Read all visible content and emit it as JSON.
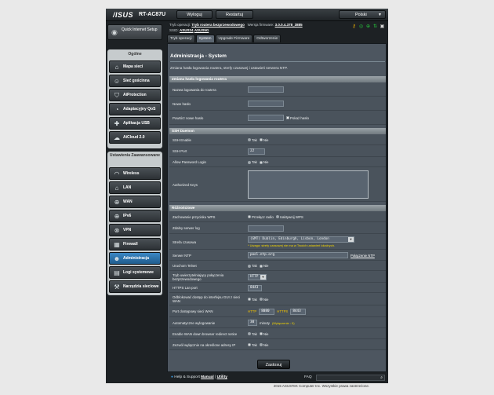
{
  "header": {
    "brand": "/ISUS",
    "model": "RT-AC87U",
    "logout_label": "Wyloguj",
    "restart_label": "Restartuj",
    "language_label": "Polski"
  },
  "info": {
    "mode_label": "Tryb operacji:",
    "mode_value": "Tryb routera bezprzewodowego",
    "fw_label": "Wersja firmware:",
    "fw_value": "3.0.0.4.378_3885",
    "ssid_label": "SSID:",
    "ssid_1": "ASUS24",
    "ssid_2": "ASUS5G"
  },
  "sidebar": {
    "qis_label": "Quick Internet Setup",
    "general_header": "Ogólne",
    "general_items": [
      {
        "label": "Mapa sieci"
      },
      {
        "label": "Sieć gościnna"
      },
      {
        "label": "AiProtection"
      },
      {
        "label": "Adaptacyjny QoS"
      },
      {
        "label": "Aplikacja USB"
      },
      {
        "label": "AiCloud 2.0"
      }
    ],
    "advanced_header": "Ustawienia Zaawansowane",
    "advanced_items": [
      {
        "label": "Wireless"
      },
      {
        "label": "LAN"
      },
      {
        "label": "WAN"
      },
      {
        "label": "IPv6"
      },
      {
        "label": "VPN"
      },
      {
        "label": "Firewall"
      },
      {
        "label": "Administracja"
      },
      {
        "label": "Logi systemowe"
      },
      {
        "label": "Narzędzia sieciowe"
      }
    ]
  },
  "tabs": [
    "Tryb operacji",
    "System",
    "Upgrade Firmware",
    "Odtworzenie"
  ],
  "page": {
    "title": "Administracja - System",
    "description": "Zmiana hasła logowania routera, strefy czasowej i ustawień serwera NTP.",
    "section_login": "Zmiana hasła logowania routera",
    "login_name_label": "Nazwa logowania do routera",
    "login_name_value": "",
    "new_pw_label": "Nowe hasło",
    "new_pw_value": "",
    "retype_pw_label": "Powtórz nowe hasło",
    "retype_pw_value": "",
    "show_pw_label": "Pokaż hasło",
    "section_ssh": "SSH Daemon",
    "ssh_enable_label": "SSH Enable",
    "ssh_port_label": "SSH Port",
    "ssh_port_value": "22",
    "allow_pw_label": "Allow Password Login",
    "auth_keys_label": "Authorized Keys",
    "section_misc": "Różnościowe",
    "wps_label": "Zachowanie przycisku WPS",
    "wps_opt1": "Przełącz radio",
    "wps_opt2": "Uaktywnij WPS",
    "remote_log_label": "Zdalny serwer log",
    "remote_log_value": "",
    "timezone_label": "Strefa czasowa",
    "timezone_value": "(GMT) Dublin, Edinburgh, Lisbon, London",
    "timezone_warning": "* Uwaga: strefy czasowej nie ma w Twoich ustawień lokalnych.",
    "ntp_label": "Serwer NTP",
    "ntp_value": "pool.ntp.org",
    "ntp_link": "Połączenie NTP",
    "telnet_label": "Uruchom Telnet",
    "auth_method_label": "Tryb uwierzytelniający połączenia bezprzewodowego",
    "auth_method_value": "HTTP",
    "https_port_label": "HTTPS Lan port",
    "https_port_value": "8443",
    "web_wan_label": "Odblokować dostęp do interfejsu GUI z sieci WAN",
    "wan_port_label": "Port dostępowy sieci WAN",
    "wan_http_label": "HTTP",
    "wan_http_value": "8080",
    "wan_https_label": "HTTPS",
    "wan_https_value": "8443",
    "auto_logout_label": "Automatyczne wylogowanie",
    "auto_logout_value": "30",
    "auto_logout_unit": "minuty",
    "auto_logout_hint": "(Wyłączenie : 0)",
    "redirect_label": "Enable WAN down browser redirect notice",
    "ip_restrict_label": "Zezwól wyłącznie na określone adresy IP",
    "yes": "Tak",
    "no": "Nie",
    "apply_label": "Zastosuj"
  },
  "footer": {
    "help_label": "Help & Support",
    "manual_label": "Manual",
    "utility_label": "Utility",
    "faq_label": "FAQ",
    "copyright": "2015 ASUSTeK Computer Inc. Wszystkie prawa zastrzeżone."
  }
}
